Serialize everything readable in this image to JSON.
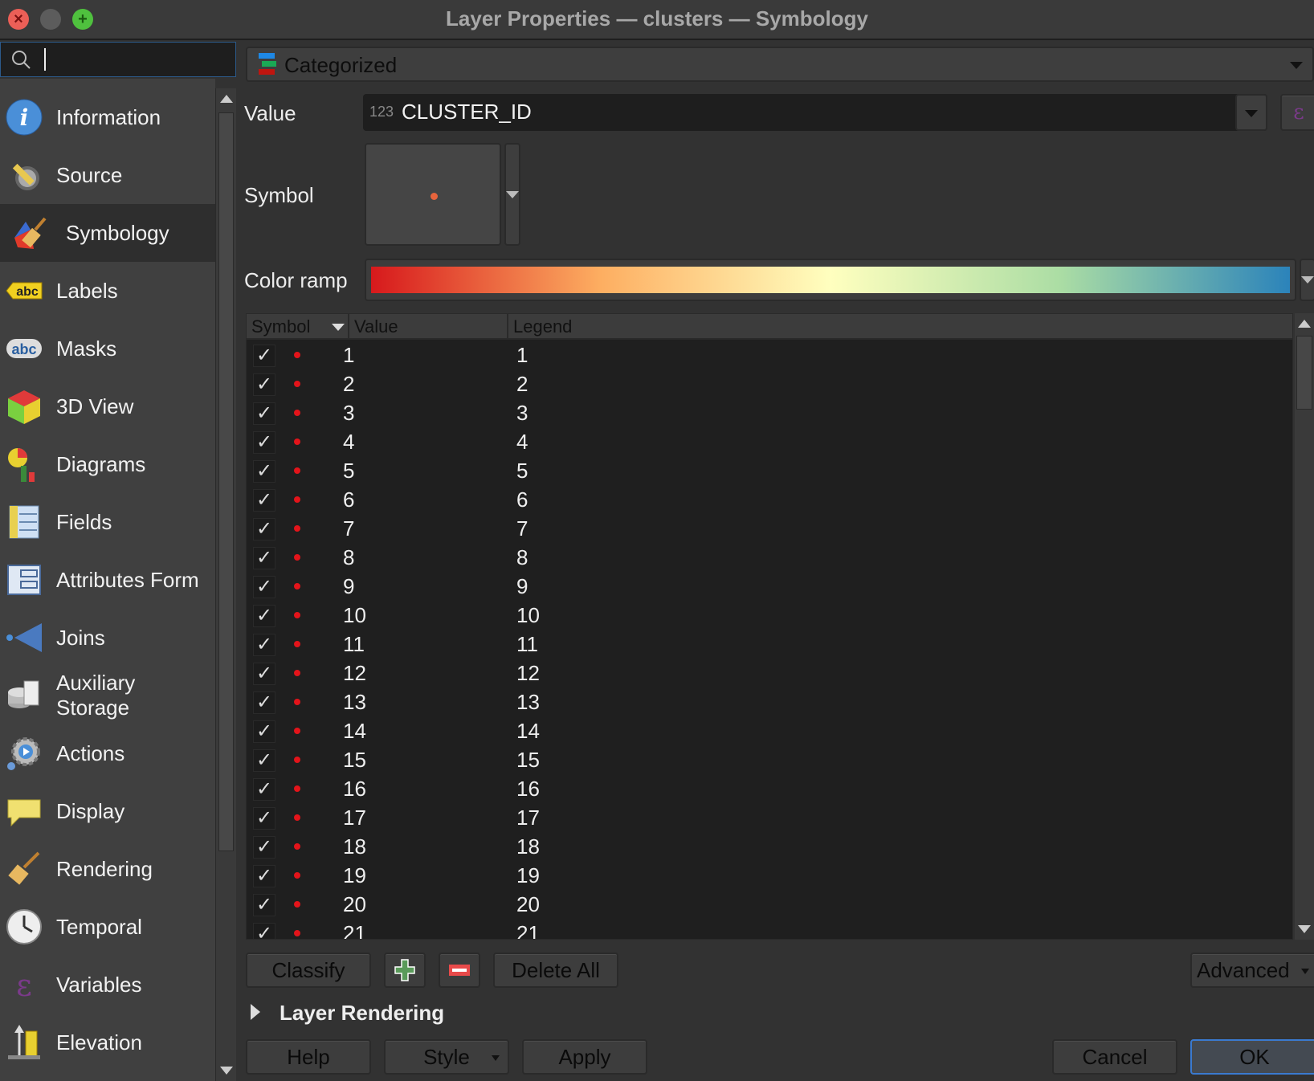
{
  "window": {
    "title": "Layer Properties — clusters — Symbology"
  },
  "search": {
    "value": ""
  },
  "sidebar": {
    "items": [
      {
        "label": "Information",
        "icon": "info-icon"
      },
      {
        "label": "Source",
        "icon": "source-icon"
      },
      {
        "label": "Symbology",
        "icon": "symbology-icon",
        "selected": true
      },
      {
        "label": "Labels",
        "icon": "labels-icon"
      },
      {
        "label": "Masks",
        "icon": "masks-icon"
      },
      {
        "label": "3D View",
        "icon": "3d-view-icon"
      },
      {
        "label": "Diagrams",
        "icon": "diagrams-icon"
      },
      {
        "label": "Fields",
        "icon": "fields-icon"
      },
      {
        "label": "Attributes Form",
        "icon": "attributes-form-icon"
      },
      {
        "label": "Joins",
        "icon": "joins-icon"
      },
      {
        "label": "Auxiliary Storage",
        "icon": "auxiliary-storage-icon"
      },
      {
        "label": "Actions",
        "icon": "actions-icon"
      },
      {
        "label": "Display",
        "icon": "display-icon"
      },
      {
        "label": "Rendering",
        "icon": "rendering-icon"
      },
      {
        "label": "Temporal",
        "icon": "temporal-icon"
      },
      {
        "label": "Variables",
        "icon": "variables-icon"
      },
      {
        "label": "Elevation",
        "icon": "elevation-icon"
      }
    ]
  },
  "renderer": {
    "selected": "Categorized"
  },
  "value": {
    "label": "Value",
    "type_badge": "123",
    "field": "CLUSTER_ID"
  },
  "symbol": {
    "label": "Symbol",
    "color": "#e8643c"
  },
  "color_ramp": {
    "label": "Color ramp",
    "stops": [
      "#d7191c",
      "#fdae61",
      "#ffffbf",
      "#abdda4",
      "#2b83ba"
    ]
  },
  "table": {
    "headers": [
      "Symbol",
      "Value",
      "Legend"
    ],
    "dot_color": "#e3141a",
    "rows": [
      {
        "checked": true,
        "value": "1",
        "legend": "1"
      },
      {
        "checked": true,
        "value": "2",
        "legend": "2"
      },
      {
        "checked": true,
        "value": "3",
        "legend": "3"
      },
      {
        "checked": true,
        "value": "4",
        "legend": "4"
      },
      {
        "checked": true,
        "value": "5",
        "legend": "5"
      },
      {
        "checked": true,
        "value": "6",
        "legend": "6"
      },
      {
        "checked": true,
        "value": "7",
        "legend": "7"
      },
      {
        "checked": true,
        "value": "8",
        "legend": "8"
      },
      {
        "checked": true,
        "value": "9",
        "legend": "9"
      },
      {
        "checked": true,
        "value": "10",
        "legend": "10"
      },
      {
        "checked": true,
        "value": "11",
        "legend": "11"
      },
      {
        "checked": true,
        "value": "12",
        "legend": "12"
      },
      {
        "checked": true,
        "value": "13",
        "legend": "13"
      },
      {
        "checked": true,
        "value": "14",
        "legend": "14"
      },
      {
        "checked": true,
        "value": "15",
        "legend": "15"
      },
      {
        "checked": true,
        "value": "16",
        "legend": "16"
      },
      {
        "checked": true,
        "value": "17",
        "legend": "17"
      },
      {
        "checked": true,
        "value": "18",
        "legend": "18"
      },
      {
        "checked": true,
        "value": "19",
        "legend": "19"
      },
      {
        "checked": true,
        "value": "20",
        "legend": "20"
      },
      {
        "checked": true,
        "value": "21",
        "legend": "21"
      }
    ]
  },
  "actions": {
    "classify": "Classify",
    "delete_all": "Delete All",
    "advanced": "Advanced"
  },
  "layer_rendering": {
    "label": "Layer Rendering"
  },
  "footer": {
    "help": "Help",
    "style": "Style",
    "apply": "Apply",
    "cancel": "Cancel",
    "ok": "OK"
  }
}
